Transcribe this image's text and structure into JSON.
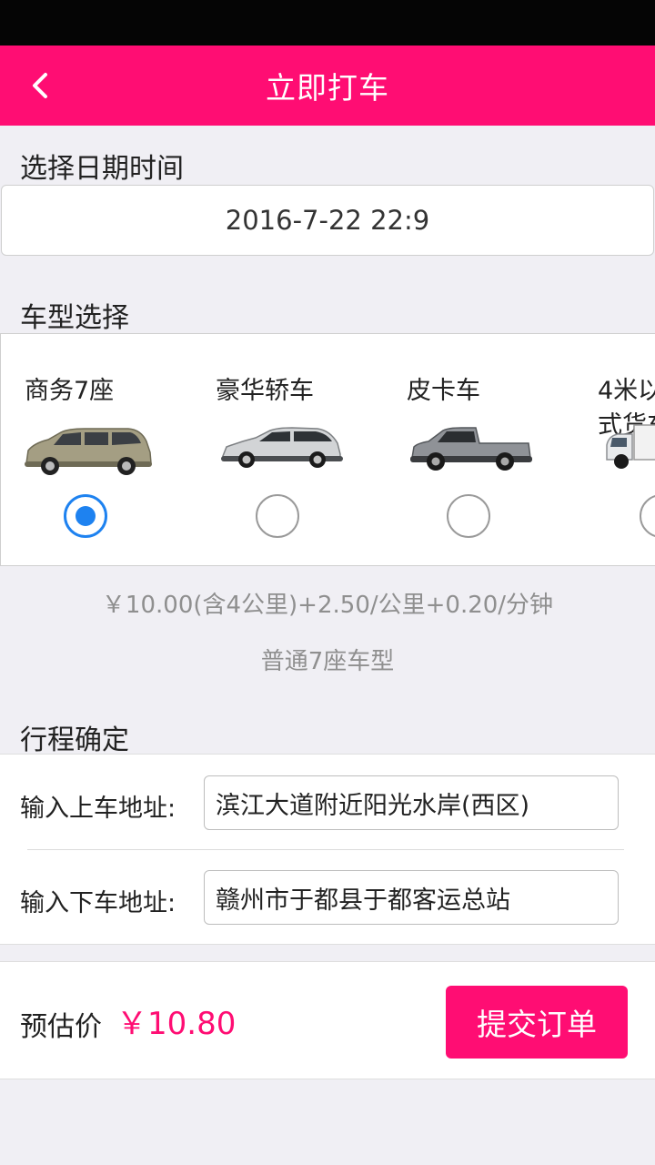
{
  "app_bar": {
    "title": "立即打车",
    "back_icon": "chevron-left-icon",
    "color": "#ff0d73"
  },
  "datetime": {
    "label": "选择日期时间",
    "value": "2016-7-22 22:9"
  },
  "car_type": {
    "label": "车型选择",
    "selected_index": 0,
    "items": [
      {
        "name": "商务7座",
        "icon": "mpv-car-icon"
      },
      {
        "name": "豪华轿车",
        "icon": "wagon-car-icon"
      },
      {
        "name": "皮卡车",
        "icon": "pickup-truck-icon"
      },
      {
        "name_line1": "4米以",
        "name_line2": "式货车",
        "icon": "cargo-truck-icon"
      }
    ],
    "price_rule": "￥10.00(含4公里)+2.50/公里+0.20/分钟",
    "description": "普通7座车型"
  },
  "trip": {
    "label": "行程确定",
    "pickup_label": "输入上车地址:",
    "pickup_value": "滨江大道附近阳光水岸(西区)",
    "dropoff_label": "输入下车地址:",
    "dropoff_value": "赣州市于都县于都客运总站"
  },
  "order": {
    "estimate_label": "预估价",
    "estimate_value": "￥10.80",
    "submit_label": "提交订单"
  }
}
